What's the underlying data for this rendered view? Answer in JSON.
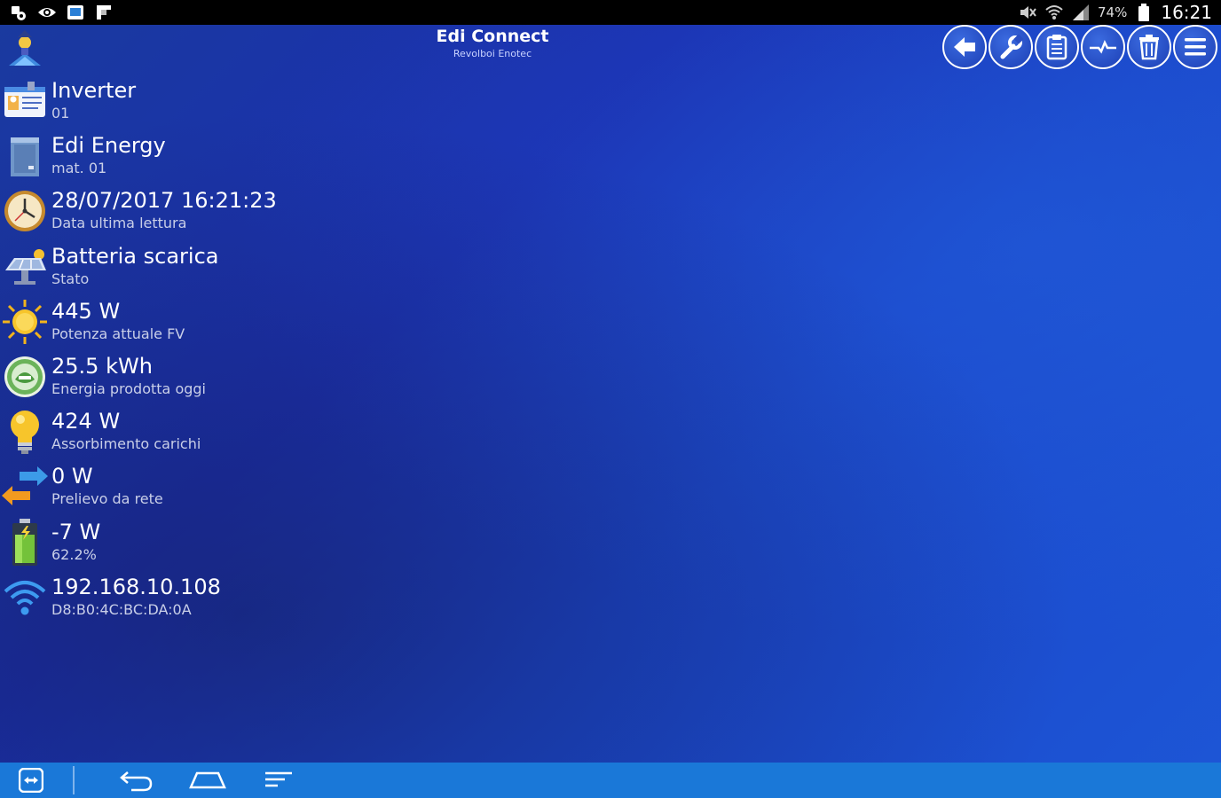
{
  "status_bar": {
    "battery_percent": "74%",
    "time": "16:21",
    "left_icons": [
      "app-notification-icon",
      "eye-icon",
      "image-icon",
      "flipboard-icon"
    ],
    "right_icons": [
      "mute-icon",
      "wifi-icon",
      "signal-icon",
      "battery-icon"
    ]
  },
  "header": {
    "title": "Edi Connect",
    "subtitle": "Revolboi Enotec",
    "toolbar": [
      {
        "name": "back-button",
        "icon": "back-arrow-icon"
      },
      {
        "name": "settings-button",
        "icon": "wrench-icon"
      },
      {
        "name": "log-button",
        "icon": "clipboard-icon"
      },
      {
        "name": "chart-button",
        "icon": "waveform-icon"
      },
      {
        "name": "delete-button",
        "icon": "trash-icon"
      },
      {
        "name": "menu-button",
        "icon": "menu-icon"
      }
    ]
  },
  "items": [
    {
      "value": "Inverter",
      "label": "01",
      "icon": "id-card-icon"
    },
    {
      "value": "Edi Energy",
      "label": "mat. 01",
      "icon": "inverter-device-icon"
    },
    {
      "value": "28/07/2017 16:21:23",
      "label": "Data ultima lettura",
      "icon": "clock-icon"
    },
    {
      "value": "Batteria scarica",
      "label": "Stato",
      "icon": "solar-panel-icon"
    },
    {
      "value": "445 W",
      "label": "Potenza attuale FV",
      "icon": "sun-icon"
    },
    {
      "value": "25.5 kWh",
      "label": "Energia prodotta oggi",
      "icon": "eco-energy-icon"
    },
    {
      "value": "424 W",
      "label": "Assorbimento carichi",
      "icon": "lightbulb-icon"
    },
    {
      "value": "0 W",
      "label": "Prelievo da rete",
      "icon": "exchange-arrows-icon"
    },
    {
      "value": "-7 W",
      "label": "62.2%",
      "icon": "battery-level-icon"
    },
    {
      "value": "192.168.10.108",
      "label": "D8:B0:4C:BC:DA:0A",
      "icon": "wifi-signal-icon"
    }
  ],
  "colors": {
    "background": "#1b2fb0",
    "navbar": "#1a78d8",
    "statusbar": "#000000"
  }
}
